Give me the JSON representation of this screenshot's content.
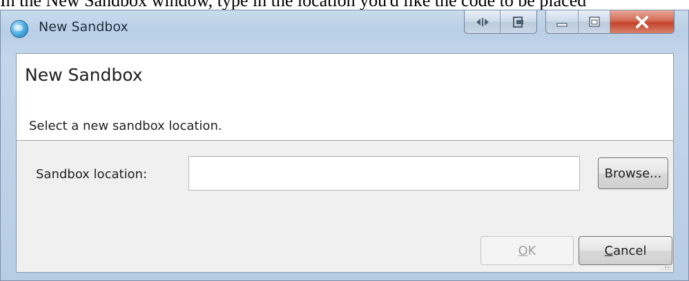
{
  "caption": "In the New Sandbox window, type in the location you'd like the code to be placed",
  "window": {
    "title": "New Sandbox",
    "icon": "globe-app-icon",
    "title_buttons": [
      "layout-toggle-icon",
      "snap-icon",
      "minimize-icon",
      "maximize-icon",
      "close-icon"
    ]
  },
  "dialog": {
    "heading": "New Sandbox",
    "description": "Select a new sandbox location.",
    "location_label": "Sandbox location:",
    "location_value": "",
    "browse_label": "Browse...",
    "ok_label": "OK",
    "ok_mnemonic": "O",
    "ok_rest": "K",
    "cancel_mnemonic": "C",
    "cancel_rest": "ancel"
  },
  "colors": {
    "frame": "#c3d6ea",
    "client": "#f0f0f0",
    "banner": "#ffffff",
    "close": "#c2432c"
  }
}
